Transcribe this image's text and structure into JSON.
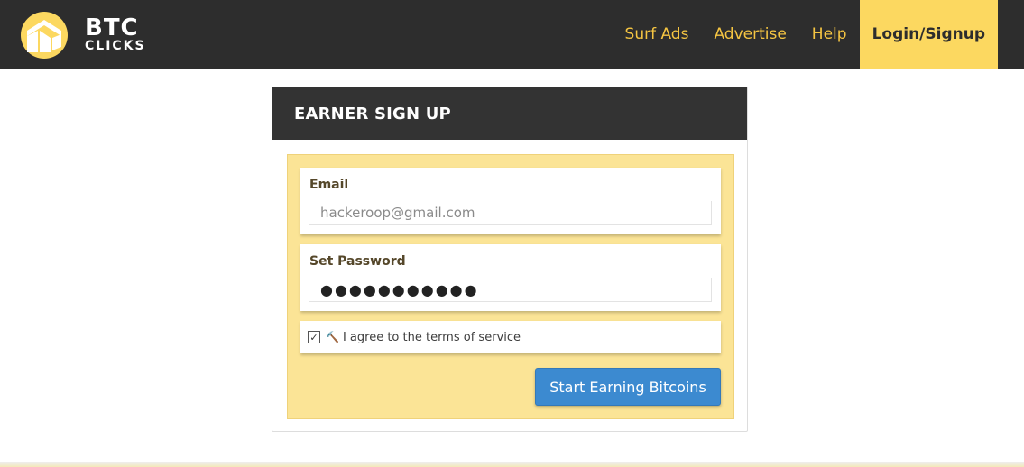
{
  "brand": {
    "line1": "BTC",
    "line2": "CLICKS",
    "accent": "#fcd860"
  },
  "nav": {
    "items": [
      {
        "label": "Surf Ads"
      },
      {
        "label": "Advertise"
      },
      {
        "label": "Help"
      },
      {
        "label": "Login/Signup"
      }
    ],
    "active_index": 3
  },
  "signup": {
    "title": "EARNER SIGN UP",
    "email_label": "Email",
    "email_value": "hackeroop@gmail.com",
    "password_label": "Set Password",
    "password_value": "●●●●●●●●●●●",
    "agree_checked": true,
    "agree_text": "I agree to the terms of service",
    "submit_label": "Start Earning Bitcoins"
  },
  "colors": {
    "topbar": "#2d2d2d",
    "nav_text": "#f5c542",
    "panel": "#fbe496",
    "button": "#3c8ad0"
  },
  "icons": {
    "logo": "btc-clicks-logo-icon",
    "checkbox": "checkbox-icon",
    "gavel": "gavel-icon"
  }
}
